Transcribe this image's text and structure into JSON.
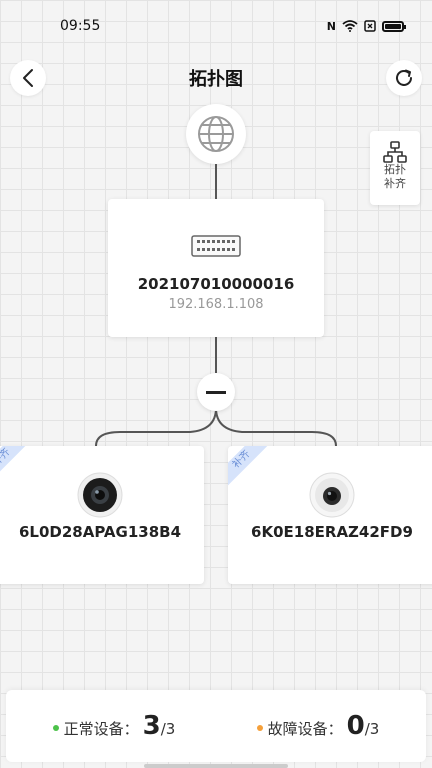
{
  "status_bar": {
    "time": "09:55",
    "icons": [
      "nfc-icon",
      "wifi-icon",
      "sim-icon",
      "battery-icon"
    ]
  },
  "header": {
    "title": "拓扑图",
    "back_icon": "chevron-left-icon",
    "refresh_icon": "refresh-icon"
  },
  "align_button": {
    "label_line1": "拓扑",
    "label_line2": "补齐",
    "icon": "topology-icon"
  },
  "root_node": {
    "icon": "globe-icon"
  },
  "switch_node": {
    "serial": "202107010000016",
    "ip": "192.168.1.108",
    "icon": "switch-icon"
  },
  "collapse_button": {
    "icon": "minus-icon"
  },
  "cameras": [
    {
      "serial": "6L0D28APAG138B4",
      "tag": "补齐",
      "icon": "camera-icon"
    },
    {
      "serial": "6K0E18ERAZ42FD9",
      "tag": "补齐",
      "icon": "camera-icon"
    }
  ],
  "footer": {
    "normal": {
      "label": "正常设备：",
      "count": "3",
      "total": "/3",
      "color": "#4cc24a"
    },
    "fault": {
      "label": "故障设备：",
      "count": "0",
      "total": "/3",
      "color": "#f5a03a"
    }
  }
}
